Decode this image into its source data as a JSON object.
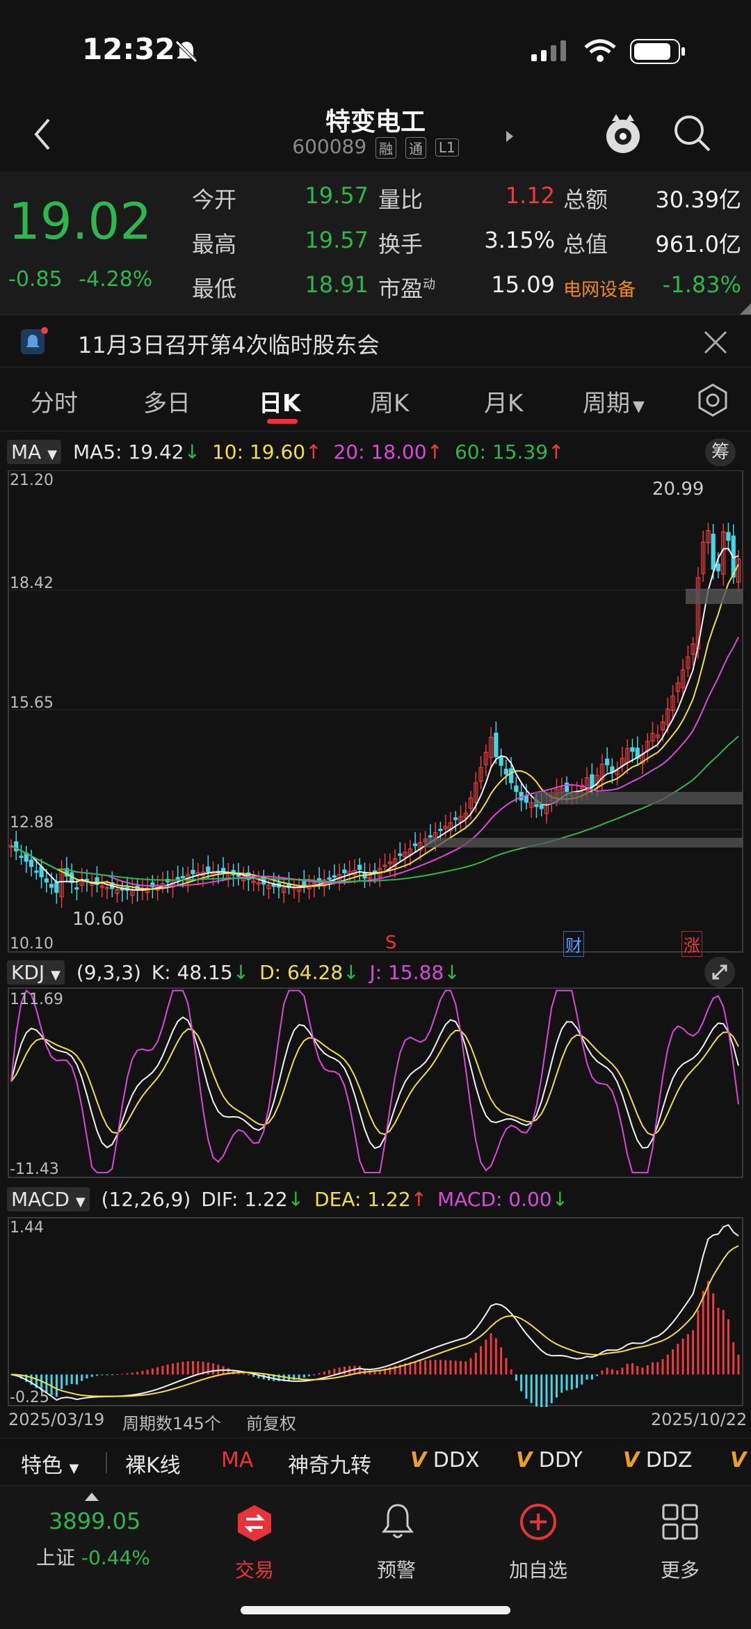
{
  "status_bar": {
    "time": "12:32"
  },
  "header": {
    "stock_name": "特变电工",
    "stock_code": "600089",
    "badges": [
      "融",
      "通",
      "L1"
    ]
  },
  "quote": {
    "price": "19.02",
    "change": "-0.85",
    "change_pct": "-4.28%",
    "rows": [
      [
        {
          "label": "今开",
          "value": "19.57",
          "color": "green"
        },
        {
          "label": "量比",
          "value": "1.12",
          "color": "red"
        },
        {
          "label": "总额",
          "value": "30.39亿",
          "color": "white"
        }
      ],
      [
        {
          "label": "最高",
          "value": "19.57",
          "color": "green"
        },
        {
          "label": "换手",
          "value": "3.15%",
          "color": "white"
        },
        {
          "label": "总值",
          "value": "961.0亿",
          "color": "white"
        }
      ],
      [
        {
          "label": "最低",
          "value": "18.91",
          "color": "green"
        },
        {
          "label": "市盈",
          "sup": "动",
          "value": "15.09",
          "color": "white"
        },
        {
          "label": "电网设备",
          "value": "-1.83%",
          "color": "green"
        }
      ]
    ]
  },
  "notice": {
    "text": "11月3日召开第4次临时股东会"
  },
  "tabs": [
    "分时",
    "多日",
    "日K",
    "周K",
    "月K",
    "周期"
  ],
  "active_tab": "日K",
  "ma": {
    "selector": "MA",
    "items": [
      {
        "label": "MA5: 19.42",
        "arrow": "↓",
        "color": "#f2f2f2",
        "arrow_color": "#2db84d"
      },
      {
        "label": "10: 19.60",
        "arrow": "↑",
        "color": "#f0e040",
        "arrow_color": "#ef3b3b"
      },
      {
        "label": "20: 18.00",
        "arrow": "↑",
        "color": "#d94ad9",
        "arrow_color": "#ef3b3b"
      },
      {
        "label": "60: 15.39",
        "arrow": "↑",
        "color": "#2db84d",
        "arrow_color": "#ef3b3b"
      }
    ],
    "chip_btn": "筹"
  },
  "kline_axis": {
    "ticks": [
      "21.20",
      "18.42",
      "15.65",
      "12.88",
      "10.10"
    ],
    "max_label": "20.99",
    "min_label": "10.60"
  },
  "event_markers": [
    {
      "label": "S"
    },
    {
      "label": "财"
    },
    {
      "label": "涨"
    }
  ],
  "kdj": {
    "selector": "KDJ",
    "params": "(9,3,3)",
    "items": [
      {
        "label": "K: 48.15",
        "arrow": "↓",
        "color": "#f2f2f2"
      },
      {
        "label": "D: 64.28",
        "arrow": "↓",
        "color": "#f0e040"
      },
      {
        "label": "J: 15.88",
        "arrow": "↓",
        "color": "#d94ad9"
      }
    ],
    "top": "111.69",
    "bottom": "-11.43"
  },
  "macd": {
    "selector": "MACD",
    "params": "(12,26,9)",
    "items": [
      {
        "label": "DIF: 1.22",
        "arrow": "↓",
        "color": "#f2f2f2",
        "arrow_color": "#2db84d"
      },
      {
        "label": "DEA: 1.22",
        "arrow": "↑",
        "color": "#f0e040",
        "arrow_color": "#ef3b3b"
      },
      {
        "label": "MACD: 0.00",
        "arrow": "↓",
        "color": "#d94ad9",
        "arrow_color": "#2db84d"
      }
    ],
    "top": "1.44",
    "bottom": "-0.25"
  },
  "footer_info": {
    "start_date": "2025/03/19",
    "period_count": "周期数145个",
    "adjust": "前复权",
    "end_date": "2025/10/22"
  },
  "toolbar": {
    "items": [
      "特色",
      "裸K线",
      "MA",
      "神奇九转",
      "DDX",
      "DDY",
      "DDZ"
    ],
    "v_prefix": "V"
  },
  "bottom_nav": {
    "index_value": "3899.05",
    "index_name": "上证",
    "index_change": "-0.44%",
    "items": [
      "交易",
      "预警",
      "加自选",
      "更多"
    ]
  },
  "colors": {
    "up": "#ef3b3b",
    "down": "#2db84d",
    "cyan": "#40d8e8",
    "accent": "#e8333a"
  },
  "chart_data": {
    "type": "candlestick",
    "x_range": [
      "2025/03/19",
      "2025/10/22"
    ],
    "ylim": [
      10.1,
      21.2
    ],
    "points": 145,
    "high": 20.99,
    "low": 10.6
  }
}
